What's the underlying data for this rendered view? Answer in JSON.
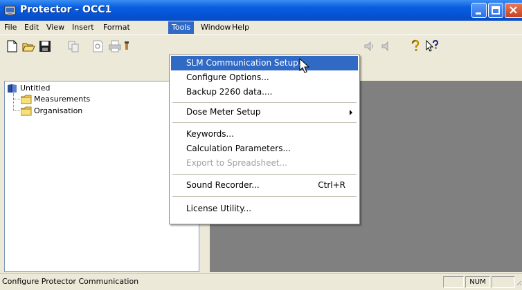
{
  "window": {
    "title": "Protector - OCC1"
  },
  "menubar": {
    "items": [
      "File",
      "Edit",
      "View",
      "Insert",
      "Format",
      "Tools",
      "Window",
      "Help"
    ],
    "active": "Tools"
  },
  "toolbar": {
    "icons": [
      "new-icon",
      "open-icon",
      "save-icon",
      "copy-icon",
      "print-preview-icon",
      "print-icon",
      "tool-icon",
      "speaker-icon",
      "speaker-muted-icon",
      "help-icon",
      "context-help-icon"
    ]
  },
  "tree": {
    "root": "Untitled",
    "children": [
      "Measurements",
      "Organisation"
    ]
  },
  "tools_menu": {
    "items": [
      {
        "label": "SLM Communication Setup...",
        "shortcut": "",
        "submenu": false,
        "disabled": false,
        "highlighted": true
      },
      {
        "label": "Configure Options...",
        "shortcut": "",
        "submenu": false,
        "disabled": false,
        "highlighted": false
      },
      {
        "label": "Backup 2260 data....",
        "shortcut": "",
        "submenu": false,
        "disabled": false,
        "highlighted": false
      },
      {
        "label": "Dose Meter Setup",
        "shortcut": "",
        "submenu": true,
        "disabled": false,
        "highlighted": false
      },
      {
        "label": "Keywords...",
        "shortcut": "",
        "submenu": false,
        "disabled": false,
        "highlighted": false
      },
      {
        "label": "Calculation Parameters...",
        "shortcut": "",
        "submenu": false,
        "disabled": false,
        "highlighted": false
      },
      {
        "label": "Export to Spreadsheet...",
        "shortcut": "",
        "submenu": false,
        "disabled": true,
        "highlighted": false
      },
      {
        "label": "Sound Recorder...",
        "shortcut": "Ctrl+R",
        "submenu": false,
        "disabled": false,
        "highlighted": false
      },
      {
        "label": "License Utility...",
        "shortcut": "",
        "submenu": false,
        "disabled": false,
        "highlighted": false
      }
    ]
  },
  "statusbar": {
    "text": "Configure Protector Communication",
    "num": "NUM"
  },
  "colors": {
    "titlebar": "#0553d6",
    "highlight": "#316ac5",
    "workspace": "#808080",
    "chrome": "#ece9d8"
  }
}
